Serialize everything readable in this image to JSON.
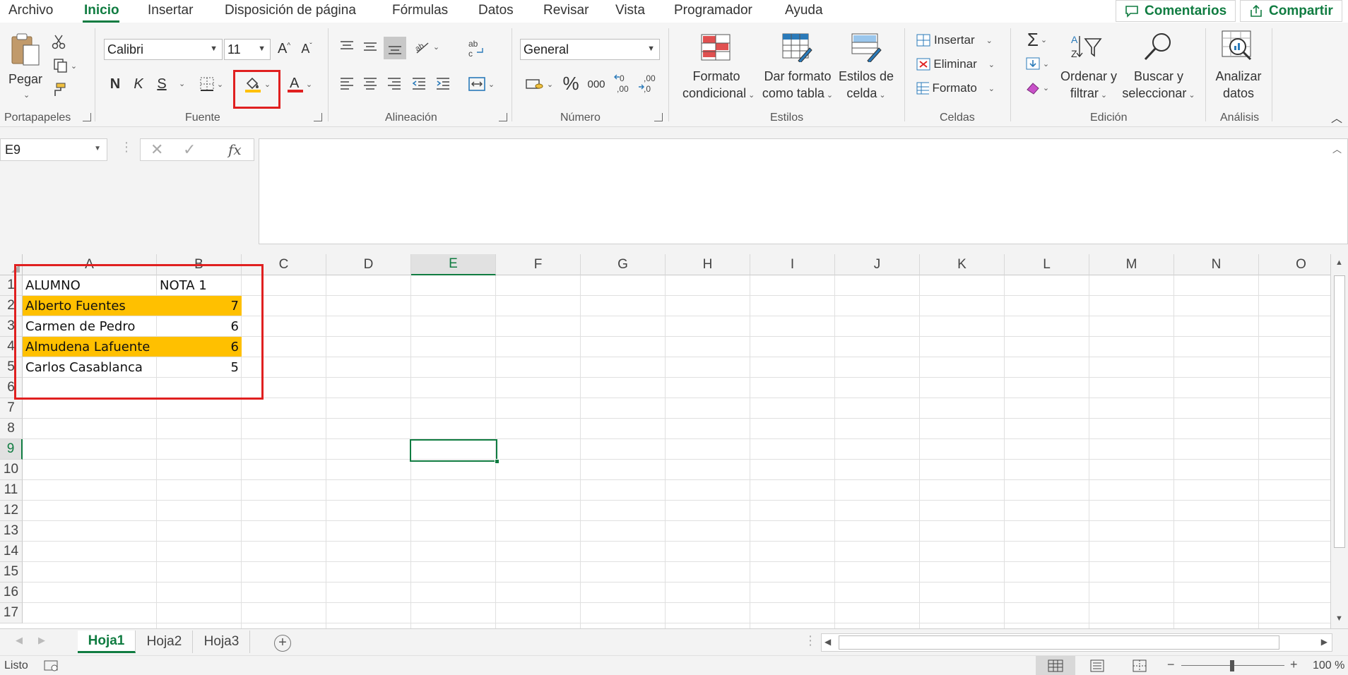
{
  "menu": {
    "tabs": [
      "Archivo",
      "Inicio",
      "Insertar",
      "Disposición de página",
      "Fórmulas",
      "Datos",
      "Revisar",
      "Vista",
      "Programador",
      "Ayuda"
    ],
    "active_tab": "Inicio",
    "comments_label": "Comentarios",
    "share_label": "Compartir"
  },
  "ribbon": {
    "clipboard": {
      "paste_label": "Pegar",
      "group_label": "Portapapeles"
    },
    "font": {
      "font_name": "Calibri",
      "font_size": "11",
      "bold": "N",
      "italic": "K",
      "underline": "S",
      "group_label": "Fuente"
    },
    "alignment": {
      "group_label": "Alineación"
    },
    "number": {
      "format": "General",
      "percent": "%",
      "thousands": "000",
      "group_label": "Número"
    },
    "styles": {
      "conditional_line1": "Formato",
      "conditional_line2": "condicional",
      "table_line1": "Dar formato",
      "table_line2": "como tabla",
      "cell_line1": "Estilos de",
      "cell_line2": "celda",
      "group_label": "Estilos"
    },
    "cells": {
      "insert": "Insertar",
      "delete": "Eliminar",
      "format": "Formato",
      "group_label": "Celdas"
    },
    "editing": {
      "sort_line1": "Ordenar y",
      "sort_line2": "filtrar",
      "find_line1": "Buscar y",
      "find_line2": "seleccionar",
      "group_label": "Edición"
    },
    "analysis": {
      "line1": "Analizar",
      "line2": "datos",
      "group_label": "Análisis"
    }
  },
  "formula_bar": {
    "name_box": "E9",
    "fx": "fx",
    "content": ""
  },
  "grid": {
    "columns": [
      "A",
      "B",
      "C",
      "D",
      "E",
      "F",
      "G",
      "H",
      "I",
      "J",
      "K",
      "L",
      "M",
      "N",
      "O"
    ],
    "rows": [
      "1",
      "2",
      "3",
      "4",
      "5",
      "6",
      "7",
      "8",
      "9",
      "10",
      "11",
      "12",
      "13",
      "14",
      "15",
      "16",
      "17"
    ],
    "selected_cell": "E9",
    "highlight_color": "#ffc000",
    "data": [
      {
        "a": "ALUMNO",
        "b": "NOTA 1",
        "highlight": false
      },
      {
        "a": "Alberto Fuentes",
        "b": "7",
        "highlight": true
      },
      {
        "a": "Carmen de Pedro",
        "b": "6",
        "highlight": false
      },
      {
        "a": "Almudena Lafuente",
        "b": "6",
        "highlight": true
      },
      {
        "a": "Carlos Casablanca",
        "b": "5",
        "highlight": false
      }
    ]
  },
  "sheets": {
    "tabs": [
      "Hoja1",
      "Hoja2",
      "Hoja3"
    ],
    "active": "Hoja1"
  },
  "status": {
    "ready": "Listo",
    "zoom": "100 %"
  }
}
